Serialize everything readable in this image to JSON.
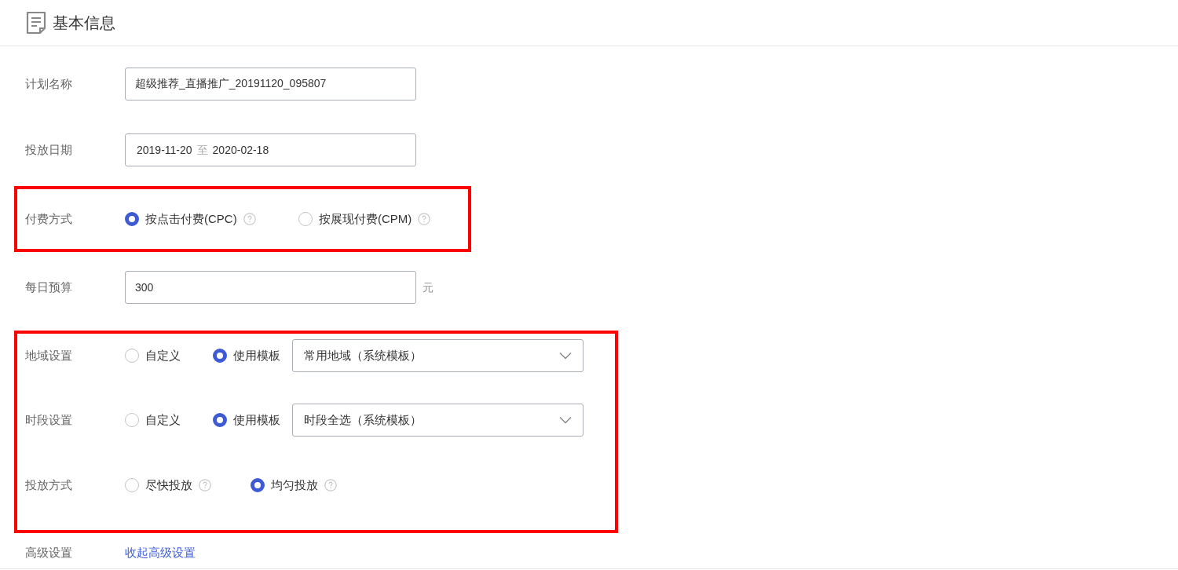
{
  "header": {
    "title": "基本信息"
  },
  "groups": [
    {
      "highlighted": false,
      "rows": [
        {
          "kind": "input",
          "label": "计划名称",
          "value": "超级推荐_直播推广_20191120_095807"
        },
        {
          "kind": "date_range",
          "label": "投放日期",
          "start": "2019-11-20",
          "separator": "至",
          "end": "2020-02-18"
        }
      ]
    },
    {
      "highlighted": true,
      "rows": [
        {
          "kind": "radio",
          "label": "付费方式",
          "options": [
            {
              "label": "按点击付费(CPC)",
              "selected": true,
              "help": true
            },
            {
              "label": "按展现付费(CPM)",
              "selected": false,
              "help": true
            }
          ]
        }
      ]
    },
    {
      "highlighted": false,
      "rows": [
        {
          "kind": "input",
          "label": "每日预算",
          "value": "300",
          "unit": "元"
        }
      ]
    },
    {
      "highlighted": true,
      "rows": [
        {
          "kind": "radio_select",
          "label": "地域设置",
          "options": [
            {
              "label": "自定义",
              "selected": false,
              "help": false
            },
            {
              "label": "使用模板",
              "selected": true,
              "help": false
            }
          ],
          "select": "常用地域（系统模板）"
        },
        {
          "kind": "radio_select",
          "label": "时段设置",
          "options": [
            {
              "label": "自定义",
              "selected": false,
              "help": false
            },
            {
              "label": "使用模板",
              "selected": true,
              "help": false
            }
          ],
          "select": "时段全选（系统模板）"
        },
        {
          "kind": "radio",
          "label": "投放方式",
          "options": [
            {
              "label": "尽快投放",
              "selected": false,
              "help": true
            },
            {
              "label": "均匀投放",
              "selected": true,
              "help": true
            }
          ]
        }
      ]
    },
    {
      "highlighted": false,
      "rows": [
        {
          "kind": "link",
          "label": "高级设置",
          "link": "收起高级设置"
        }
      ]
    }
  ]
}
